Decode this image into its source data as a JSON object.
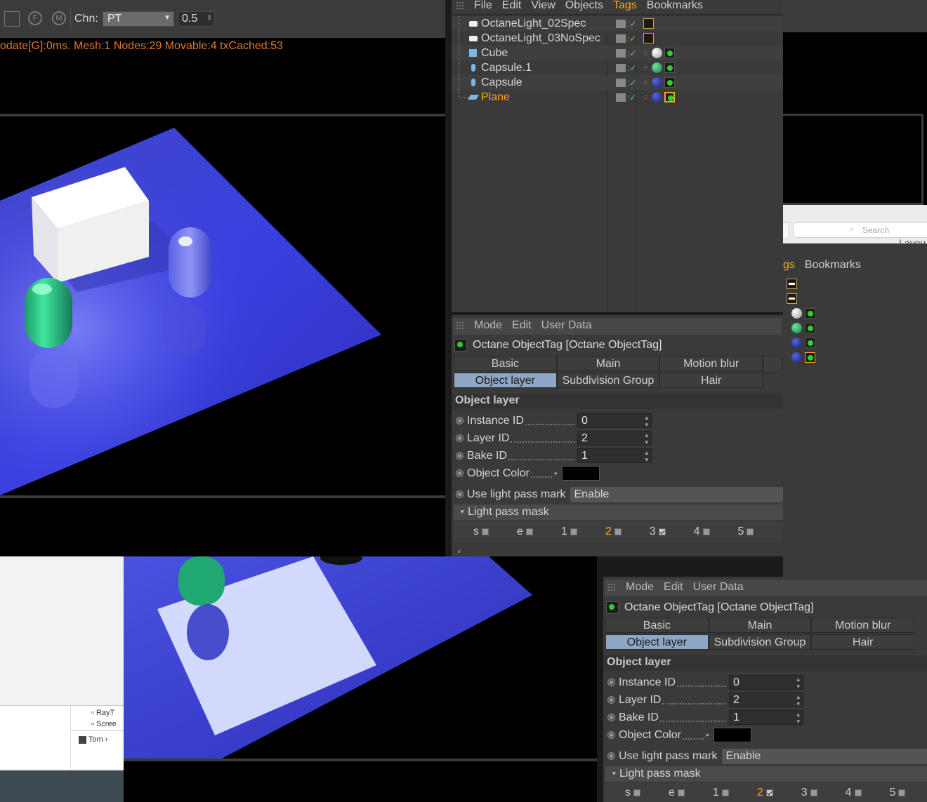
{
  "viewport": {
    "toolbar": {
      "channel_label": "Chn:",
      "channel_value": "PT",
      "value": "0.5"
    },
    "status_text": "odate[G]:0ms. Mesh:1 Nodes:29 Movable:4 txCached:53"
  },
  "object_manager": {
    "menu": [
      "File",
      "Edit",
      "View",
      "Objects",
      "Tags",
      "Bookmarks"
    ],
    "objects": [
      {
        "name": "OctaneLight_02Spec"
      },
      {
        "name": "OctaneLight_03NoSpec"
      },
      {
        "name": "Cube"
      },
      {
        "name": "Capsule.1"
      },
      {
        "name": "Capsule"
      },
      {
        "name": "Plane"
      }
    ]
  },
  "attributes": {
    "menu": [
      "Mode",
      "Edit",
      "User Data"
    ],
    "title": "Octane ObjectTag [Octane ObjectTag]",
    "tabs_row1": [
      "Basic",
      "Main",
      "Motion blur"
    ],
    "tabs_row2": [
      "Object layer",
      "Subdivision Group",
      "Hair"
    ],
    "section": "Object layer",
    "fields": {
      "instance_id": {
        "label": "Instance ID",
        "value": "0"
      },
      "layer_id": {
        "label": "Layer ID",
        "value": "2"
      },
      "bake_id": {
        "label": "Bake ID",
        "value": "1"
      },
      "object_color": {
        "label": "Object Color"
      },
      "light_pass": {
        "label": "Use light pass mark",
        "value": "Enable"
      }
    },
    "mask_section": "Light pass mask",
    "mask": [
      "s",
      "e",
      "1",
      "2",
      "3",
      "4",
      "5"
    ]
  },
  "back_window": {
    "search_placeholder": "Search",
    "layout_partial": "Layou",
    "menu_partial": [
      "gs",
      "Bookmarks"
    ],
    "finder_items": [
      "RayT",
      "Scree"
    ],
    "finder_path": "Tom"
  }
}
